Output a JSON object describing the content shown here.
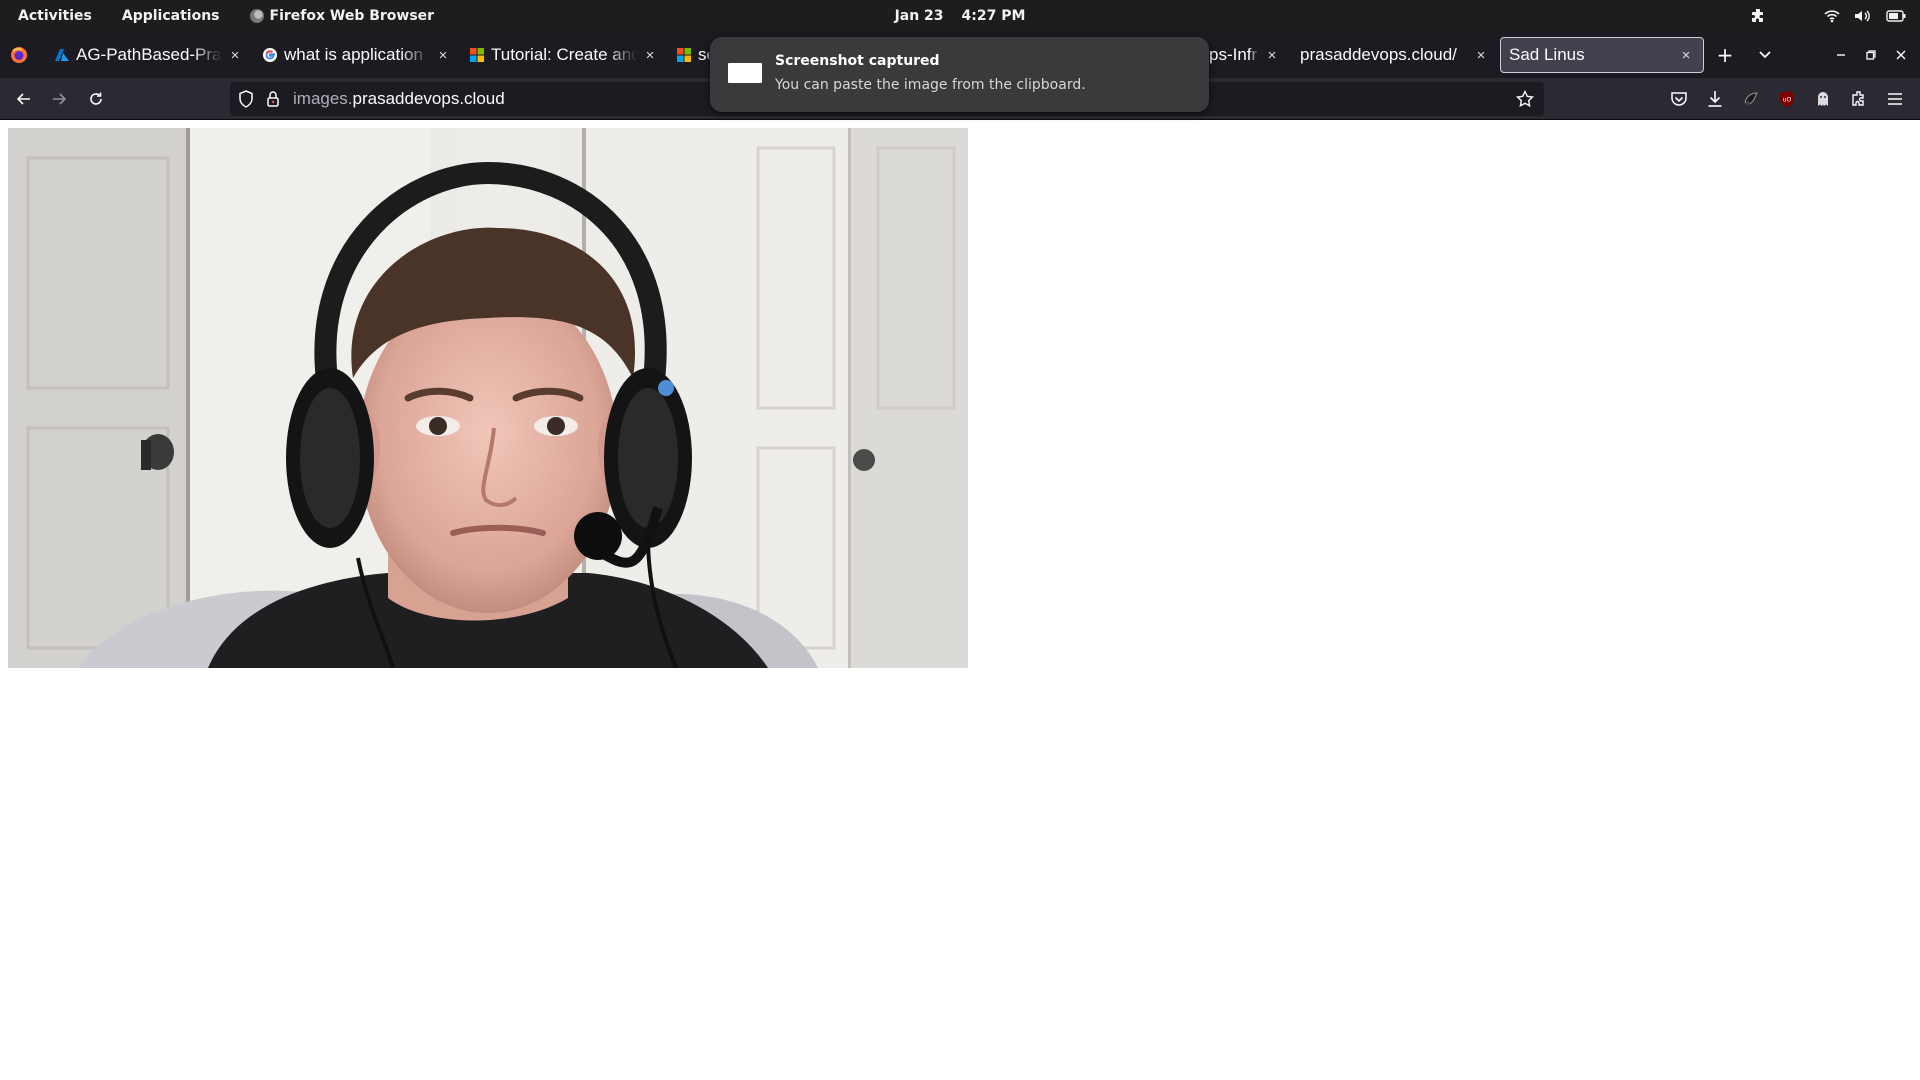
{
  "topbar": {
    "activities": "Activities",
    "applications": "Applications",
    "app_name": "Firefox Web Browser",
    "date": "Jan 23",
    "time": "4:27 PM"
  },
  "tabs": [
    {
      "label": "AG-PathBased-Prasad",
      "favicon": "azure-icon"
    },
    {
      "label": "what is application gateway",
      "favicon": "google-icon"
    },
    {
      "label": "Tutorial: Create and configure",
      "favicon": "microsoft-icon"
    },
    {
      "label": "se",
      "favicon": "microsoft-icon"
    },
    {
      "label": "ps-Infra",
      "favicon": "none"
    },
    {
      "label": "prasaddevops.cloud/",
      "favicon": "none"
    },
    {
      "label": "Sad Linus",
      "favicon": "none",
      "active": true
    }
  ],
  "tab_close_glyph": "×",
  "new_tab_glyph": "+",
  "address": {
    "domain_prefix": "images.",
    "domain_main": "prasaddevops.cloud"
  },
  "notification": {
    "title": "Screenshot captured",
    "body": "You can paste the image from the clipboard."
  },
  "content": {
    "image_subject": "man with headset in front of white doors"
  },
  "colors": {
    "topbar": "#1d1d1f",
    "tabstrip": "#1c1b22",
    "navbar": "#2b2a33",
    "active_tab": "#42414d",
    "toast": "#3a3a3c"
  }
}
